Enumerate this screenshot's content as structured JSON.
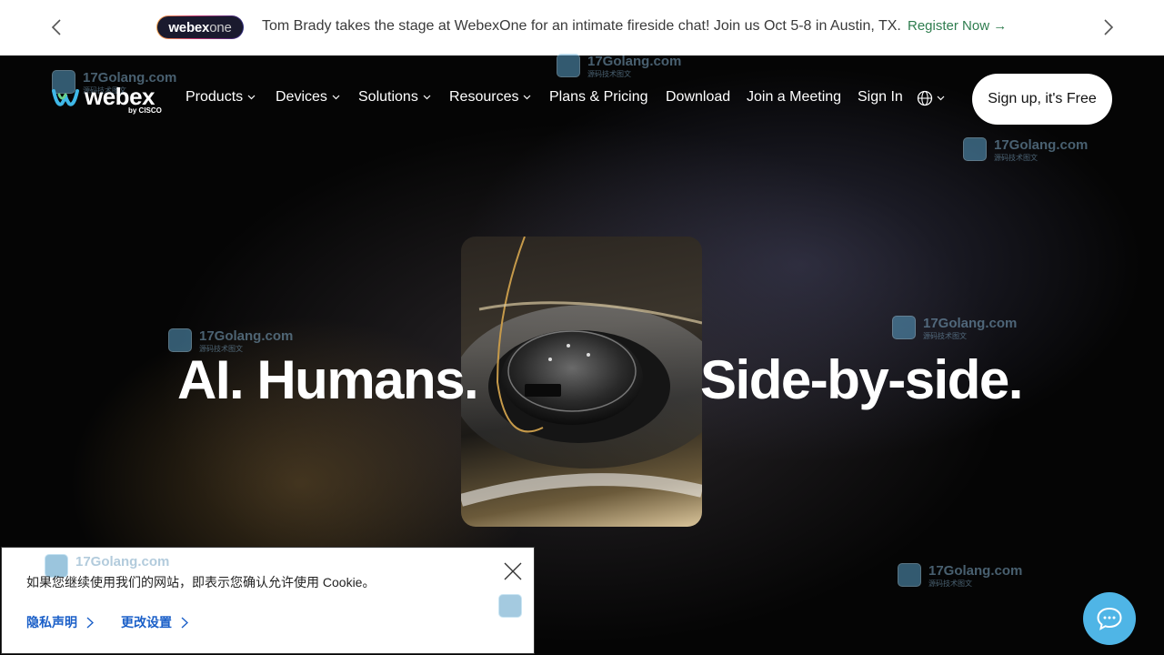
{
  "announcement": {
    "badge_main": "webex",
    "badge_suffix": "one",
    "text": "Tom Brady takes the stage at WebexOne for an intimate fireside chat! Join us Oct 5-8 in Austin, TX.",
    "cta": "Register Now →"
  },
  "logo": {
    "word": "webex",
    "byline": "by CISCO"
  },
  "nav": {
    "items": [
      {
        "label": "Products"
      },
      {
        "label": "Devices"
      },
      {
        "label": "Solutions"
      },
      {
        "label": "Resources"
      },
      {
        "label": "Plans & Pricing"
      },
      {
        "label": "Download"
      },
      {
        "label": "Join a Meeting"
      },
      {
        "label": "Sign In"
      }
    ],
    "signup": "Sign up, it's Free"
  },
  "hero": {
    "left": "AI. Humans.",
    "right": "Side-by-side."
  },
  "watermark": {
    "site": "17Golang.com",
    "sub": "源码技术图文"
  },
  "cookie": {
    "message": "如果您继续使用我们的网站，即表示您确认允许使用 Cookie。",
    "privacy": "隐私声明",
    "settings": "更改设置"
  },
  "colors": {
    "register": "#2f7d4f",
    "cookie_link": "#1a5fc8",
    "chat": "#4fb5e6"
  }
}
